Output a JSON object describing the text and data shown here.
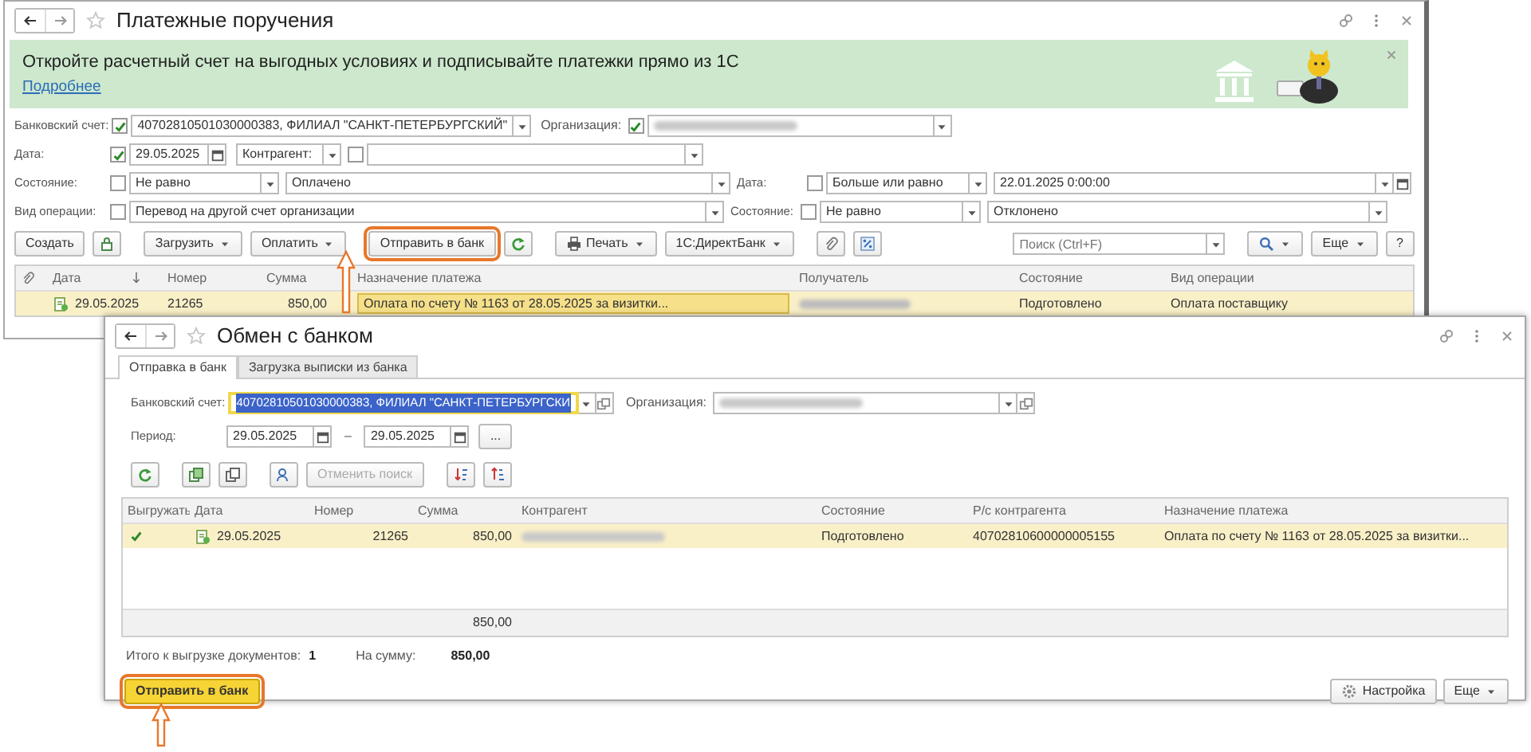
{
  "payment_orders": {
    "title": "Платежные поручения",
    "banner": {
      "text": "Откройте расчетный счет на выгодных условиях и подписывайте платежки прямо из 1С",
      "link": "Подробнее"
    },
    "bank_account": {
      "label": "Банковский счет:",
      "checked": true,
      "value": "40702810501030000383, ФИЛИАЛ \"САНКТ-ПЕТЕРБУРГСКИЙ\""
    },
    "organization": {
      "label": "Организация:",
      "checked": true
    },
    "date": {
      "label": "Дата:",
      "checked": true,
      "value": "29.05.2025"
    },
    "counterparty": {
      "selector": "Контрагент:",
      "checked": false
    },
    "status": {
      "label": "Состояние:",
      "checked": false,
      "condition": "Не равно",
      "value": "Оплачено"
    },
    "operation_type": {
      "label": "Вид операции:",
      "checked": false,
      "value": "Перевод на другой счет организации"
    },
    "date_filter": {
      "label": "Дата:",
      "checked": false,
      "condition": "Больше или равно",
      "value": "22.01.2025  0:00:00"
    },
    "status_filter": {
      "label": "Состояние:",
      "checked": false,
      "condition": "Не равно",
      "value": "Отклонено"
    },
    "toolbar": {
      "create": "Создать",
      "load": "Загрузить",
      "pay": "Оплатить",
      "send": {
        "label": "Отправить в банк",
        "annotated": true
      },
      "print": "Печать",
      "directbank": "1С:ДиректБанк",
      "search_placeholder": "Поиск (Ctrl+F)",
      "more": "Еще",
      "help": "?"
    },
    "table": {
      "columns": [
        "Дата",
        "Номер",
        "Сумма",
        "Назначение платежа",
        "Получатель",
        "Состояние",
        "Вид операции"
      ],
      "rows": [
        {
          "selected": true,
          "date": "29.05.2025",
          "number": "21265",
          "sum": "850,00",
          "purpose": "Оплата по счету № 1163 от 28.05.2025 за визитки...",
          "status": "Подготовлено",
          "operation": "Оплата поставщику"
        }
      ]
    }
  },
  "bank_exchange": {
    "title": "Обмен с банком",
    "tabs": [
      {
        "label": "Отправка в банк",
        "selected": true
      },
      {
        "label": "Загрузка выписки из банка",
        "selected": false
      }
    ],
    "bank_account": {
      "label": "Банковский счет:",
      "value": "40702810501030000383, ФИЛИАЛ \"САНКТ-ПЕТЕРБУРГСКИ",
      "focused": true
    },
    "organization": {
      "label": "Организация:"
    },
    "period": {
      "label": "Период:",
      "from": "29.05.2025",
      "separator": "–",
      "to": "29.05.2025",
      "choose": "..."
    },
    "cancel_search": {
      "label": "Отменить поиск",
      "disabled": true
    },
    "table": {
      "columns": [
        "Выгружать",
        "Дата",
        "Номер",
        "Сумма",
        "Контрагент",
        "Состояние",
        "Р/с контрагента",
        "Назначение платежа"
      ],
      "rows": [
        {
          "selected": true,
          "export": true,
          "date": "29.05.2025",
          "number": "21265",
          "sum": "850,00",
          "status": "Подготовлено",
          "account": "40702810600000005155",
          "purpose": "Оплата по счету № 1163 от 28.05.2025 за визитки..."
        }
      ],
      "total_sum": "850,00"
    },
    "summary": {
      "docs_label": "Итого к выгрузке документов:",
      "docs_count": "1",
      "sum_label": "На сумму:",
      "sum_value": "850,00"
    },
    "send_button": {
      "label": "Отправить в банк",
      "annotated": true
    },
    "settings": "Настройка",
    "more": "Еще"
  }
}
